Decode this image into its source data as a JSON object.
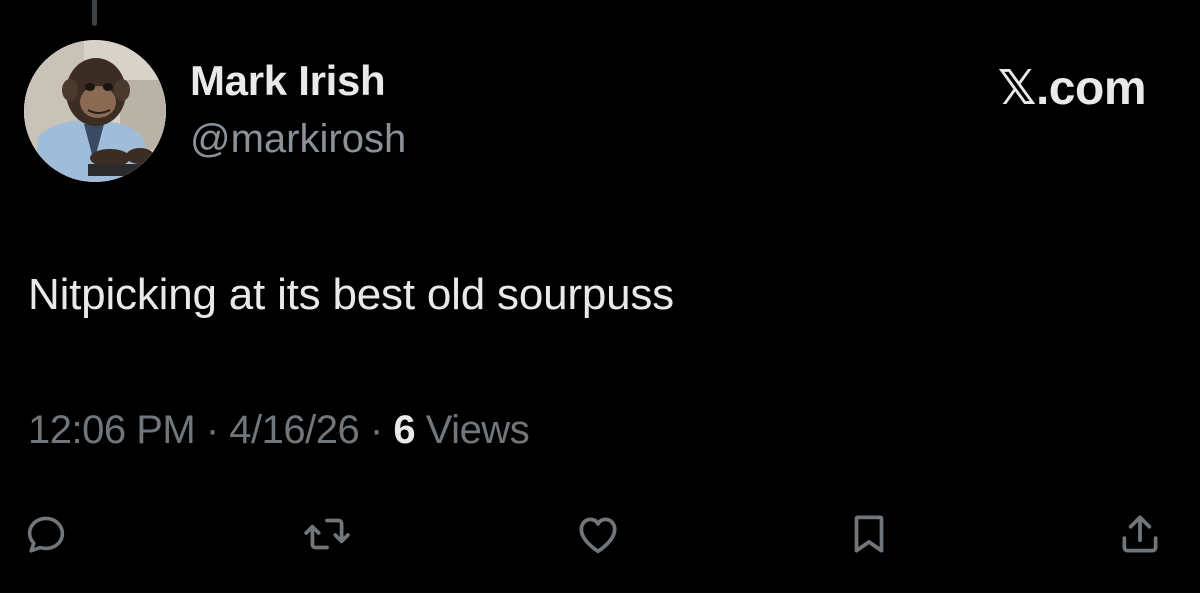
{
  "colors": {
    "background": "#000000",
    "primary_text": "#e7e9ea",
    "secondary_text": "#71767b",
    "icon": "#71767b"
  },
  "author": {
    "display_name": "Mark Irish",
    "handle": "@markirosh",
    "avatar": "chimpanzee-typing-on-laptop-avatar"
  },
  "watermark": "𝕏.com",
  "tweet": {
    "text": "Nitpicking at its best old sourpuss",
    "time": "12:06 PM",
    "separator": "·",
    "date": "4/16/26",
    "views_count": "6",
    "views_label": "Views"
  },
  "actions": [
    {
      "name": "reply",
      "icon": "speech-bubble-icon"
    },
    {
      "name": "repost",
      "icon": "repost-arrows-icon"
    },
    {
      "name": "like",
      "icon": "heart-icon"
    },
    {
      "name": "bookmark",
      "icon": "bookmark-icon"
    },
    {
      "name": "share",
      "icon": "share-upload-icon"
    }
  ]
}
